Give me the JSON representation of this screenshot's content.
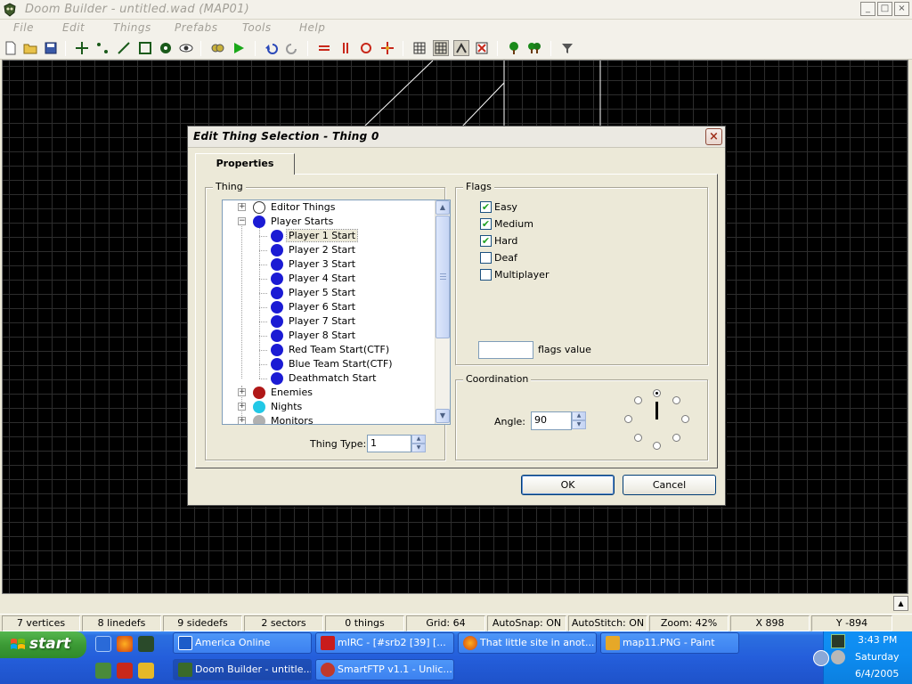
{
  "app": {
    "title": "Doom Builder - untitled.wad (MAP01)",
    "colors": {
      "grid_bg": "#000000",
      "grid_line": "#2d2d2d",
      "map_line": "#ffffff",
      "titlebar_text": "#a29f97"
    }
  },
  "window_buttons": [
    "_",
    "□",
    "×"
  ],
  "menu": {
    "items": [
      "File",
      "Edit",
      "Things",
      "Prefabs",
      "Tools",
      "Help"
    ]
  },
  "toolbar": {
    "icons": [
      "new-file-icon",
      "open-folder-icon",
      "save-icon",
      "move-mode-icon",
      "vertices-mode-icon",
      "linedefs-mode-icon",
      "sectors-mode-icon",
      "things-mode-icon",
      "3d-mode-icon",
      "find-icon",
      "test-map-icon",
      "undo-icon",
      "redo-icon",
      "flip-horizontal-icon",
      "flip-vertical-icon",
      "rotate-icon",
      "resize-icon",
      "grid-icon",
      "snap-grid-icon",
      "stitch-icon",
      "merge-icon",
      "tree-icon",
      "forest-icon",
      "filter-icon"
    ]
  },
  "dialog": {
    "title": "Edit Thing Selection - Thing 0",
    "close_label": "×",
    "tab_label": "Properties",
    "thing_group_label": "Thing",
    "tree": [
      {
        "label": "Editor Things",
        "level": 0,
        "expander": "+",
        "icon_color": "#ffffff"
      },
      {
        "label": "Player Starts",
        "level": 0,
        "expander": "−",
        "icon_color": "#1b1bd4"
      },
      {
        "label": "Player 1 Start",
        "level": 1,
        "icon_color": "#1b1bd4",
        "selected": true
      },
      {
        "label": "Player 2 Start",
        "level": 1,
        "icon_color": "#1b1bd4"
      },
      {
        "label": "Player 3 Start",
        "level": 1,
        "icon_color": "#1b1bd4"
      },
      {
        "label": "Player 4 Start",
        "level": 1,
        "icon_color": "#1b1bd4"
      },
      {
        "label": "Player 5 Start",
        "level": 1,
        "icon_color": "#1b1bd4"
      },
      {
        "label": "Player 6 Start",
        "level": 1,
        "icon_color": "#1b1bd4"
      },
      {
        "label": "Player 7 Start",
        "level": 1,
        "icon_color": "#1b1bd4"
      },
      {
        "label": "Player 8 Start",
        "level": 1,
        "icon_color": "#1b1bd4"
      },
      {
        "label": "Red Team Start(CTF)",
        "level": 1,
        "icon_color": "#1b1bd4"
      },
      {
        "label": "Blue Team Start(CTF)",
        "level": 1,
        "icon_color": "#1b1bd4"
      },
      {
        "label": "Deathmatch Start",
        "level": 1,
        "icon_color": "#1b1bd4"
      },
      {
        "label": "Enemies",
        "level": 0,
        "expander": "+",
        "icon_color": "#b01818"
      },
      {
        "label": "Nights",
        "level": 0,
        "expander": "+",
        "icon_color": "#22c8e6"
      },
      {
        "label": "Monitors",
        "level": 0,
        "expander": "+",
        "icon_color": "#b0b0b0"
      }
    ],
    "thing_type_label": "Thing Type:",
    "thing_type_value": "1",
    "flags_group_label": "Flags",
    "flags": [
      {
        "label": "Easy",
        "checked": true
      },
      {
        "label": "Medium",
        "checked": true
      },
      {
        "label": "Hard",
        "checked": true
      },
      {
        "label": "Deaf",
        "checked": false
      },
      {
        "label": "Multiplayer",
        "checked": false
      }
    ],
    "flags_value_label": "flags value",
    "flags_value": "",
    "coordination_group_label": "Coordination",
    "angle_label": "Angle:",
    "angle_value": "90",
    "ok_label": "OK",
    "cancel_label": "Cancel"
  },
  "statusbar": {
    "cells": [
      "7 vertices",
      "8 linedefs",
      "9 sidedefs",
      "2 sectors",
      "0 things",
      "Grid: 64",
      "AutoSnap: ON",
      "AutoStitch: ON",
      "Zoom: 42%",
      "X 898",
      "Y -894"
    ]
  },
  "taskbar": {
    "start_label": "start",
    "tasks_row1": [
      {
        "label": "America  Online",
        "icon_color": "#1c5cc9"
      },
      {
        "label": "mIRC - [#srb2 [39] [...",
        "icon_color": "#c81c1c"
      },
      {
        "label": "That little site in anot...",
        "icon_color": "#e07a18"
      },
      {
        "label": "map11.PNG - Paint",
        "icon_color": "#e6a828"
      }
    ],
    "tasks_row2": [
      {
        "label": "Doom Builder - untitle...",
        "icon_color": "#3a6a2a",
        "active": true
      },
      {
        "label": "SmartFTP v1.1 - Unlic...",
        "icon_color": "#c0392b"
      }
    ],
    "clock": {
      "time": "3:43 PM",
      "day": "Saturday",
      "date": "6/4/2005"
    }
  }
}
